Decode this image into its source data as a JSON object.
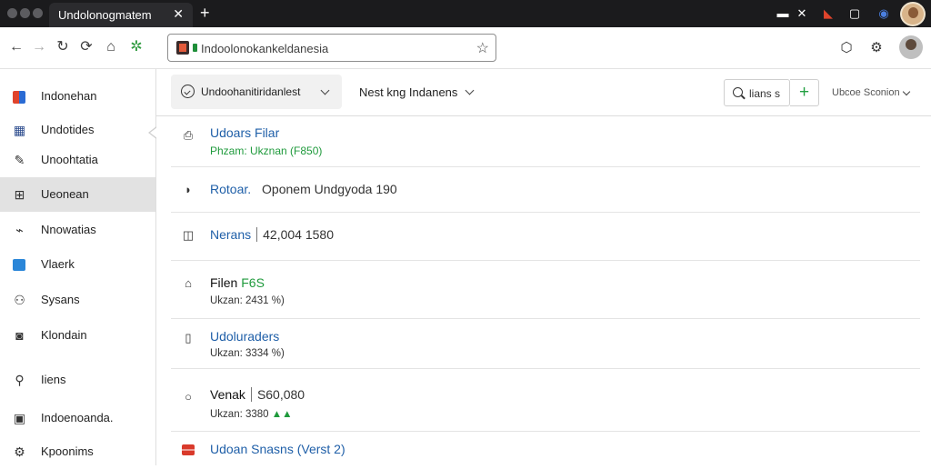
{
  "browser": {
    "tab_title": "Undolonogmatem",
    "tab_close": "✕",
    "new_tab": "+",
    "url": "Indoolonokankeldanesia",
    "colors": {
      "titlebar": "#1b1b1d",
      "accent_green": "#1f9a3c",
      "link_blue": "#1f5fa8"
    },
    "icons": [
      "back-arrow-icon",
      "forward-arrow-icon",
      "reload-icon",
      "refresh-alt-icon",
      "home-icon",
      "extension-icon",
      "star-icon",
      "shield-icon",
      "account-icon"
    ]
  },
  "sidebar": {
    "items": [
      {
        "label": "Indonehan",
        "icon": "grid-color-icon"
      },
      {
        "label": "Undotides",
        "icon": "keyboard-icon"
      },
      {
        "label": "Unoohtatia",
        "icon": "pen-icon"
      },
      {
        "label": "Ueonean",
        "icon": "table-icon",
        "active": true
      },
      {
        "label": "Nnowatias",
        "icon": "tag-icon"
      },
      {
        "label": "Vlaerk",
        "icon": "image-icon"
      },
      {
        "label": "Sysans",
        "icon": "people-icon"
      },
      {
        "label": "Klondain",
        "icon": "camera-icon"
      },
      {
        "label": "Iiens",
        "icon": "search-icon"
      },
      {
        "label": "Indoenoanda.",
        "icon": "document-icon"
      },
      {
        "label": "Kpoonims",
        "icon": "gear-icon"
      }
    ]
  },
  "header": {
    "filter_label": "Undoohanitiridanlest",
    "second_dropdown": "Nest kng Indanens",
    "search_label": "lians s",
    "add_label": "+",
    "sort_label": "Ubcoe Sconion"
  },
  "rows": [
    {
      "title": "Udoars Filar",
      "subtitle": "Phzam: Ukznan (F850)",
      "icon": "clipboard-icon"
    },
    {
      "title": "Rotoar.",
      "title_extra": "Oponem Undgyoda 190",
      "icon": "moon-icon"
    },
    {
      "title": "Nerans",
      "title_extra": "42,004 1580",
      "icon": "columns-icon"
    },
    {
      "title": "Filen",
      "title_badge": "F6S",
      "subtitle": "Ukzan: 2431 %)",
      "icon": "bank-icon"
    },
    {
      "title": "Udoluraders",
      "subtitle": "Ukzan: 3334 %)",
      "icon": "file-icon"
    },
    {
      "title": "Venak",
      "title_extra": "S60,080",
      "subtitle": "Ukzan: 3380",
      "subtitle_badge": "▲▲",
      "icon": "circle-icon"
    },
    {
      "title": "Udoan Snasns (Verst 2)",
      "icon": "flag-icon"
    }
  ]
}
